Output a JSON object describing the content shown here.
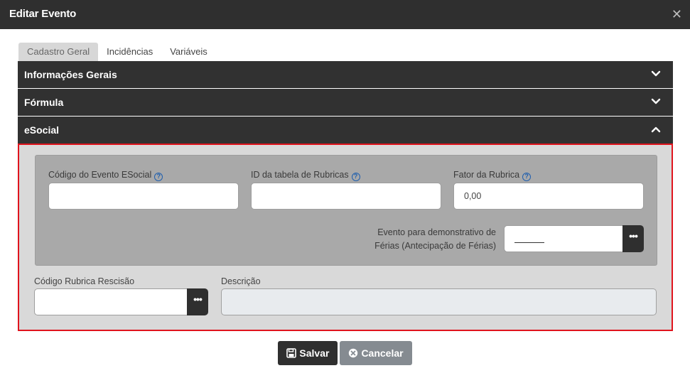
{
  "dialog": {
    "title": "Editar Evento",
    "close_glyph": "✕"
  },
  "tabs": [
    {
      "label": "Cadastro Geral",
      "active": true
    },
    {
      "label": "Incidências",
      "active": false
    },
    {
      "label": "Variáveis",
      "active": false
    }
  ],
  "sections": [
    {
      "title": "Informações Gerais",
      "state": "collapsed",
      "icon": "chevron-down-icon"
    },
    {
      "title": "Fórmula",
      "state": "collapsed",
      "icon": "chevron-down-icon"
    },
    {
      "title": "eSocial",
      "state": "expanded",
      "icon": "chevron-up-icon"
    }
  ],
  "esocial": {
    "codigo_evento_label": "Código do Evento ESocial",
    "codigo_evento_value": "",
    "id_tabela_label": "ID da tabela de Rubricas",
    "id_tabela_value": "",
    "fator_label": "Fator da Rubrica",
    "fator_value": "0,00",
    "evento_ferias_label_line1": "Evento para demonstrativo de",
    "evento_ferias_label_line2": "Férias (Antecipação de Férias)",
    "evento_ferias_value": "",
    "codigo_rescisao_label": "Código Rubrica Rescisão",
    "codigo_rescisao_value": "",
    "descricao_label": "Descrição",
    "descricao_value": "",
    "help_glyph": "?",
    "lookup_glyph": "•••"
  },
  "footer": {
    "save_label": "Salvar",
    "cancel_label": "Cancelar"
  },
  "colors": {
    "highlight_border": "#e0141d",
    "header_bg": "#2f2f2f",
    "help_icon": "#1f5fae"
  }
}
